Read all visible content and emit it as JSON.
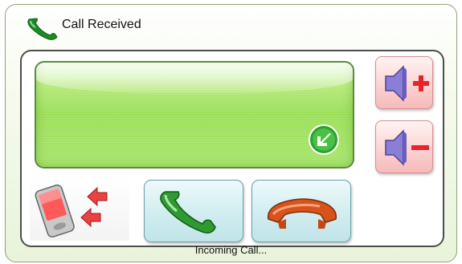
{
  "window": {
    "title": "Call Received",
    "title_icon": "phone-handset-icon"
  },
  "display": {
    "indicator_icon": "incoming-call-arrow-icon"
  },
  "volume": {
    "up_icon": "speaker-plus-icon",
    "down_icon": "speaker-minus-icon"
  },
  "device": {
    "icon": "pocket-pc-device-icon",
    "arrows_icon": "incoming-arrows-icon"
  },
  "actions": {
    "answer_icon": "green-phone-answer-icon",
    "hangup_icon": "orange-phone-hangup-icon"
  },
  "status": {
    "text": "Incoming Call..."
  },
  "colors": {
    "answer": "#2f9a32",
    "hangup": "#d8531c",
    "display_green": "#9ce05a",
    "volume_red": "#e8242a",
    "speaker_purple": "#7d6fc9"
  }
}
